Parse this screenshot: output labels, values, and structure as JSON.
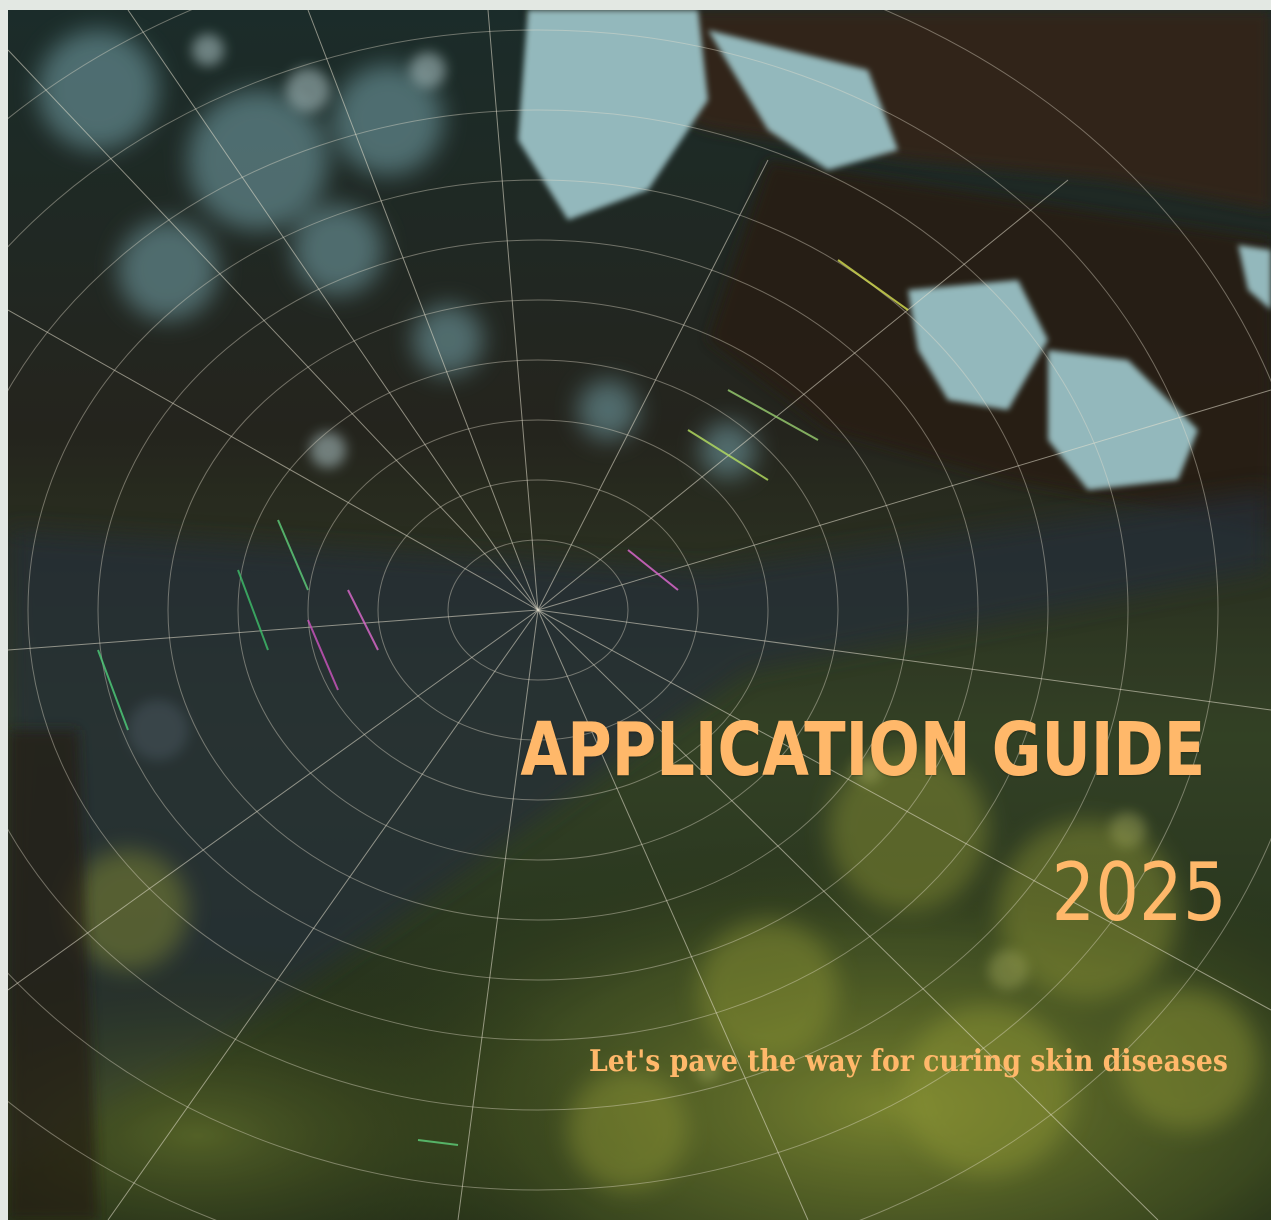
{
  "cover": {
    "title": "APPLICATION GUIDE",
    "year": "2025",
    "tagline": "Let's pave the way for curing skin diseases"
  },
  "colors": {
    "accent_text": "#ffb86a",
    "page_background": "#e3e8e3"
  }
}
